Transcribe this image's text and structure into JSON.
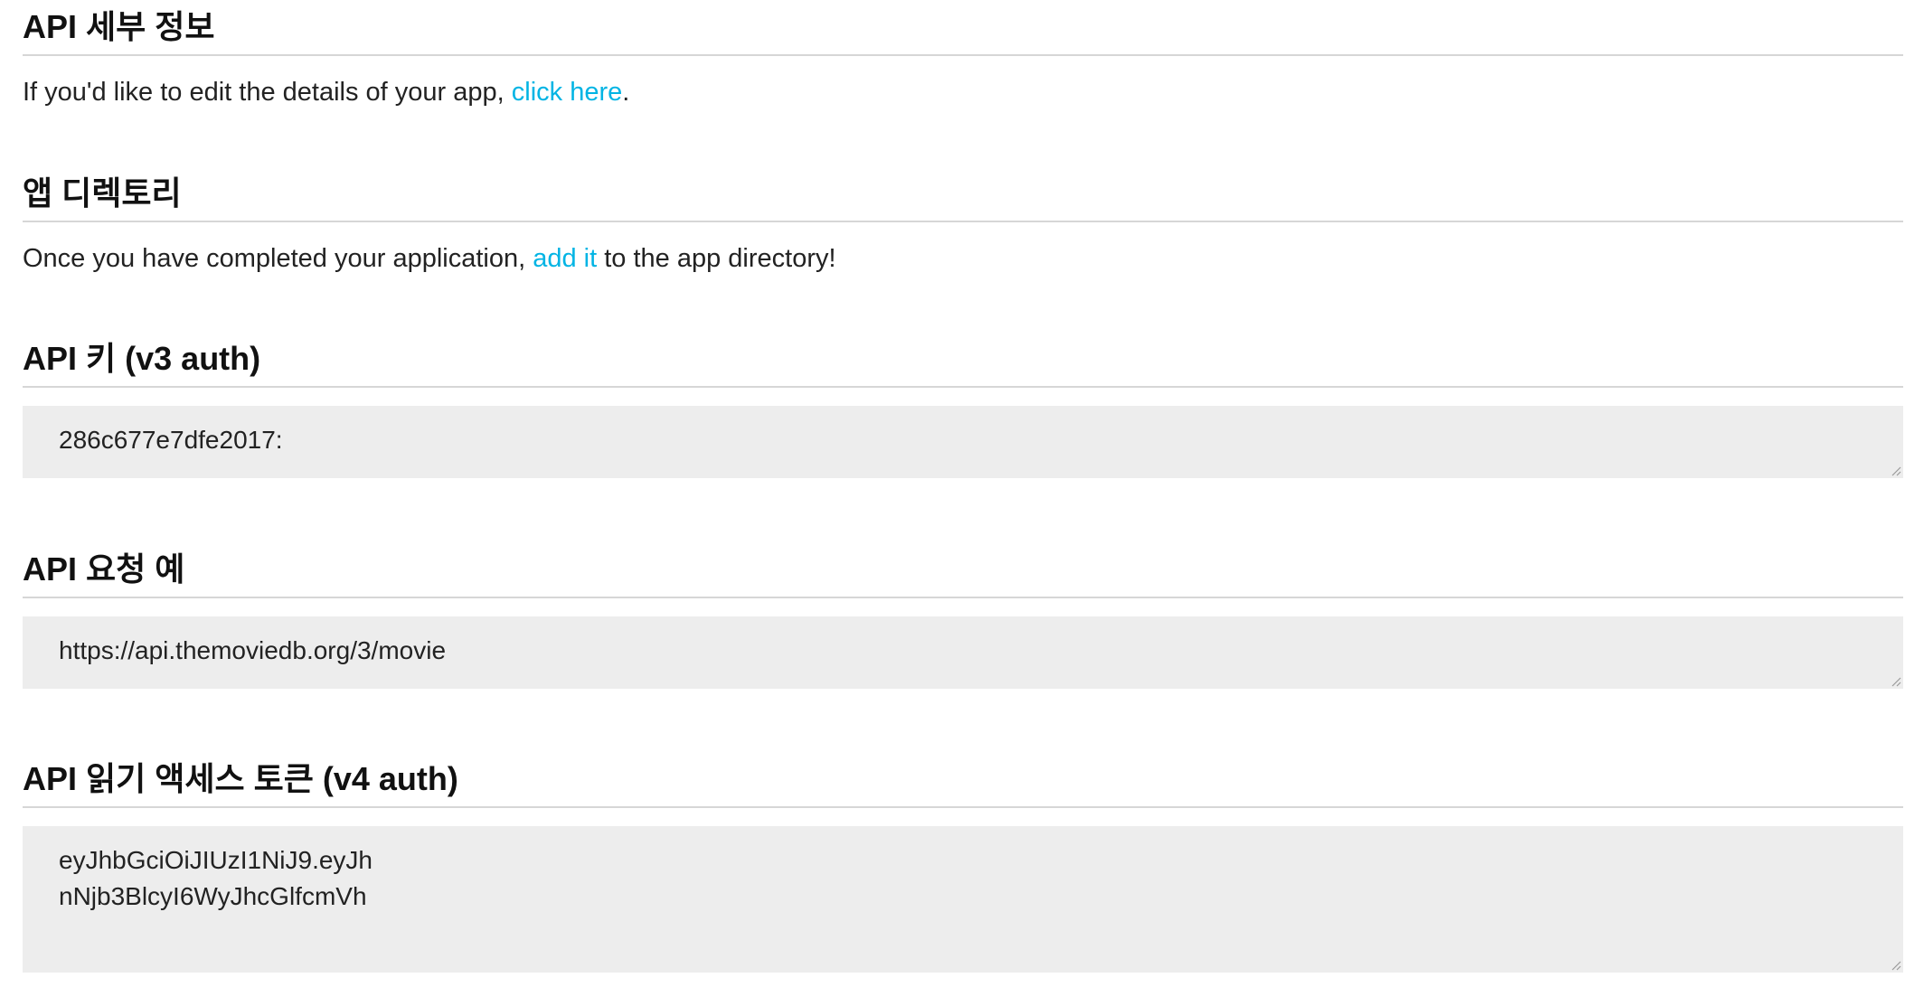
{
  "details": {
    "title": "API 세부 정보",
    "text_before": "If you'd like to edit the details of your app, ",
    "link": "click here",
    "text_after": "."
  },
  "directory": {
    "title": "앱 디렉토리",
    "text_before": "Once you have completed your application, ",
    "link": "add it",
    "text_after": " to the app directory!"
  },
  "api_key": {
    "title": "API 키 (v3 auth)",
    "value": "286c677e7dfe2017:"
  },
  "example": {
    "title": "API 요청 예",
    "value": "https://api.themoviedb.org/3/movie"
  },
  "token": {
    "title": "API 읽기 액세스 토큰 (v4 auth)",
    "line1": "eyJhbGciOiJIUzI1NiJ9.eyJh",
    "line2": "nNjb3BlcyI6WyJhcGlfcmVh"
  },
  "colors": {
    "link": "#01b4e4",
    "box_background": "#ededed",
    "divider": "#d6d6d6"
  }
}
